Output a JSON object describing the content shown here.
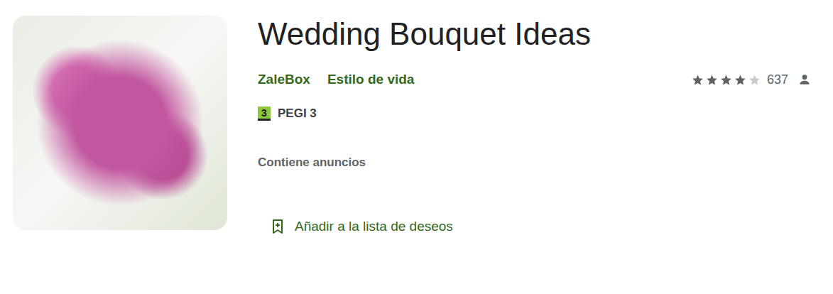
{
  "app": {
    "title": "Wedding Bouquet Ideas",
    "developer": "ZaleBox",
    "category": "Estilo de vida",
    "rating": {
      "stars": 4,
      "max": 5,
      "count": "637"
    },
    "age_rating": {
      "badge": "3",
      "label": "PEGI 3"
    },
    "ads_notice": "Contiene anuncios",
    "wishlist_button": {
      "label": "Añadir a la lista de deseos"
    }
  }
}
